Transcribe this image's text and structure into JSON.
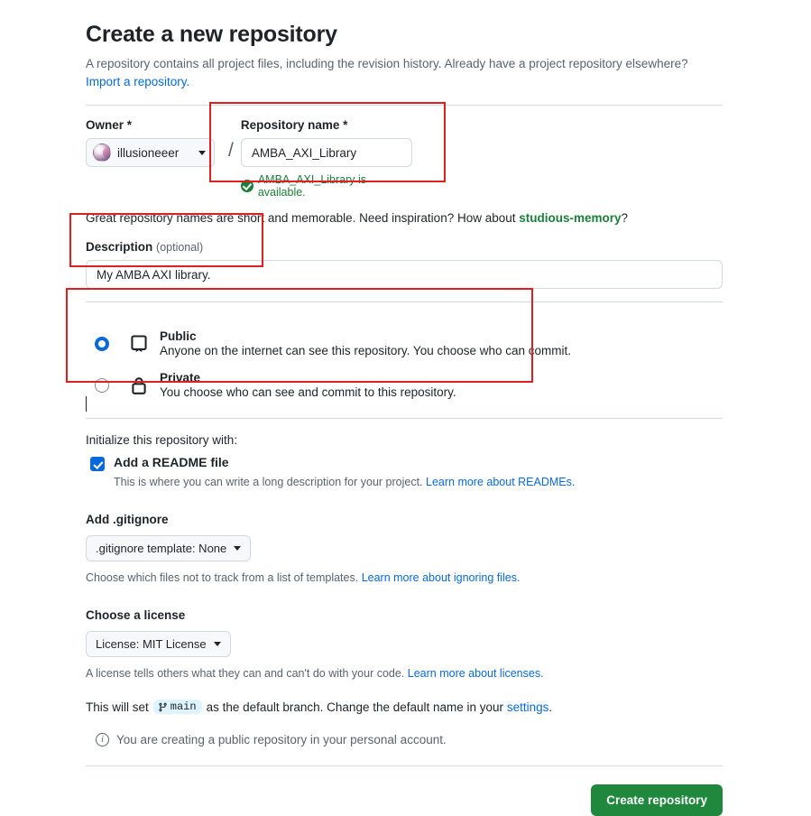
{
  "header": {
    "title": "Create a new repository",
    "subtitle_text": "A repository contains all project files, including the revision history. Already have a project repository elsewhere?",
    "import_link": "Import a repository."
  },
  "owner": {
    "label": "Owner *",
    "name": "illusioneeer",
    "separator": "/"
  },
  "repository_name": {
    "label": "Repository name *",
    "value": "AMBA_AXI_Library",
    "placeholder": "",
    "availability": "AMBA_AXI_Library is available."
  },
  "name_hint": {
    "before": "Great repository names are short and memorable. Need inspiration? How about ",
    "suggestion": "studious-memory",
    "after": "?"
  },
  "description": {
    "label": "Description",
    "optional": "(optional)",
    "value": "My AMBA AXI library.",
    "placeholder": ""
  },
  "visibility": {
    "options": [
      {
        "name": "Public",
        "description": "Anyone on the internet can see this repository. You choose who can commit.",
        "selected": true,
        "icon": "book-icon"
      },
      {
        "name": "Private",
        "description": "You choose who can see and commit to this repository.",
        "selected": false,
        "icon": "lock-icon"
      }
    ]
  },
  "initialize": {
    "heading": "Initialize this repository with:",
    "readme": {
      "label": "Add a README file",
      "checked": true,
      "note_before": "This is where you can write a long description for your project. ",
      "note_link": "Learn more about READMEs."
    },
    "gitignore": {
      "heading": "Add .gitignore",
      "select_value": ".gitignore template: None",
      "note_before": "Choose which files not to track from a list of templates. ",
      "note_link": "Learn more about ignoring files."
    },
    "license": {
      "heading": "Choose a license",
      "select_value": "License: MIT License",
      "note_before": "A license tells others what they can and can't do with your code. ",
      "note_link": "Learn more about licenses."
    }
  },
  "branch": {
    "before": "This will set",
    "name": "main",
    "middle": "as the default branch. Change the default name in your",
    "link": "settings",
    "after": "."
  },
  "footer": {
    "info_text": "You are creating a public repository in your personal account.",
    "submit_label": "Create repository"
  },
  "colors": {
    "link": "#0969da",
    "success": "#1a7f37",
    "primary_button": "#1f883d",
    "annotation": "#e02020",
    "branch_badge_bg": "#ddf4ff"
  }
}
